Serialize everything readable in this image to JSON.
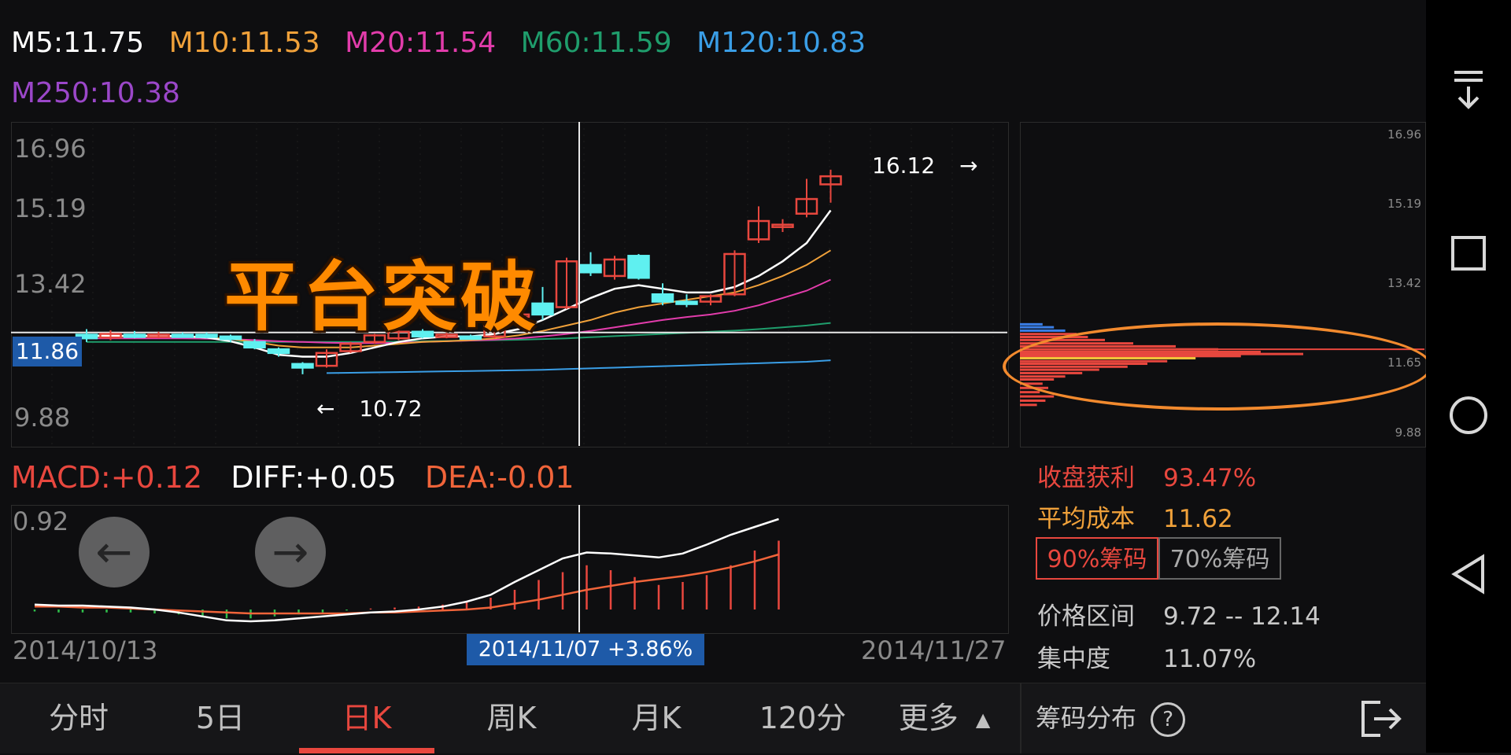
{
  "ma": {
    "m5": "M5:11.75",
    "m10": "M10:11.53",
    "m20": "M20:11.54",
    "m60": "M60:11.59",
    "m120": "M120:10.83",
    "m250": "M250:10.38"
  },
  "colors": {
    "m5": "#ffffff",
    "m10": "#f0a13a",
    "m20": "#e23cab",
    "m60": "#1f9d6c",
    "m120": "#3a9ee6",
    "m250": "#9b47c9",
    "up": "#e8473e",
    "down": "#5ff0f0",
    "accent": "#e8473e",
    "orange": "#f28a2e",
    "label_blue": "#1e5aa8"
  },
  "price_axis": [
    "16.96",
    "15.19",
    "13.42",
    "11.86",
    "9.88"
  ],
  "current_price_tag": "11.86",
  "chip_axis": [
    "16.96",
    "15.19",
    "13.42",
    "11.65",
    "9.88"
  ],
  "title_overlay": "平台突破",
  "annotations": {
    "high": "16.12",
    "low": "10.72",
    "high_arrow": "→",
    "low_arrow": "←"
  },
  "macd": {
    "macd": "MACD:+0.12",
    "diff": "DIFF:+0.05",
    "dea": "DEA:-0.01",
    "axis_top": "0.92"
  },
  "nav": {
    "prev_icon": "←",
    "next_icon": "→"
  },
  "dates": {
    "start": "2014/10/13",
    "selected": "2014/11/07  +3.86%",
    "end": "2014/11/27"
  },
  "chip_stats": {
    "profit_label": "收盘获利",
    "profit_value": "93.47%",
    "avg_cost_label": "平均成本",
    "avg_cost_value": "11.62",
    "btn_90": "90%筹码",
    "btn_70": "70%筹码",
    "range_label": "价格区间",
    "range_value": "9.72 -- 12.14",
    "concentration_label": "集中度",
    "concentration_value": "11.07%"
  },
  "tabs": [
    "分时",
    "5日",
    "日K",
    "周K",
    "月K",
    "120分",
    "更多"
  ],
  "active_tab": "日K",
  "more_caret": "▲",
  "chip_footer": {
    "label": "筹码分布",
    "help_icon": "?"
  },
  "chart_data": {
    "type": "candlestick",
    "x_start": "2014/10/13",
    "x_end": "2014/11/27",
    "ylim": [
      9.88,
      16.96
    ],
    "candles": [
      {
        "o": 11.8,
        "c": 11.7,
        "h": 11.95,
        "l": 11.6
      },
      {
        "o": 11.72,
        "c": 11.82,
        "h": 11.92,
        "l": 11.65
      },
      {
        "o": 11.8,
        "c": 11.78,
        "h": 11.9,
        "l": 11.7
      },
      {
        "o": 11.78,
        "c": 11.8,
        "h": 11.88,
        "l": 11.7
      },
      {
        "o": 11.8,
        "c": 11.79,
        "h": 11.86,
        "l": 11.72
      },
      {
        "o": 11.8,
        "c": 11.78,
        "h": 11.86,
        "l": 11.7
      },
      {
        "o": 11.75,
        "c": 11.68,
        "h": 11.8,
        "l": 11.6
      },
      {
        "o": 11.6,
        "c": 11.45,
        "h": 11.68,
        "l": 11.4
      },
      {
        "o": 11.4,
        "c": 11.3,
        "h": 11.45,
        "l": 11.2
      },
      {
        "o": 11.0,
        "c": 10.9,
        "h": 11.05,
        "l": 10.72
      },
      {
        "o": 10.95,
        "c": 11.3,
        "h": 11.4,
        "l": 10.9
      },
      {
        "o": 11.35,
        "c": 11.55,
        "h": 11.6,
        "l": 11.3
      },
      {
        "o": 11.6,
        "c": 11.78,
        "h": 11.82,
        "l": 11.55
      },
      {
        "o": 11.7,
        "c": 11.88,
        "h": 12.0,
        "l": 11.65
      },
      {
        "o": 11.88,
        "c": 11.75,
        "h": 11.95,
        "l": 11.7
      },
      {
        "o": 11.75,
        "c": 11.8,
        "h": 11.85,
        "l": 11.7
      },
      {
        "o": 11.75,
        "c": 11.72,
        "h": 11.8,
        "l": 11.68
      },
      {
        "o": 11.75,
        "c": 12.05,
        "h": 12.1,
        "l": 11.7
      },
      {
        "o": 12.3,
        "c": 12.35,
        "h": 12.5,
        "l": 12.15
      },
      {
        "o": 12.65,
        "c": 12.35,
        "h": 13.1,
        "l": 12.2
      },
      {
        "o": 12.55,
        "c": 13.8,
        "h": 13.9,
        "l": 12.5
      },
      {
        "o": 13.7,
        "c": 13.5,
        "h": 14.05,
        "l": 13.4
      },
      {
        "o": 13.4,
        "c": 13.85,
        "h": 13.95,
        "l": 13.3
      },
      {
        "o": 13.95,
        "c": 13.35,
        "h": 14.0,
        "l": 13.3
      },
      {
        "o": 12.9,
        "c": 12.7,
        "h": 13.2,
        "l": 12.6
      },
      {
        "o": 12.7,
        "c": 12.65,
        "h": 12.9,
        "l": 12.55
      },
      {
        "o": 12.7,
        "c": 12.85,
        "h": 12.9,
        "l": 12.6
      },
      {
        "o": 12.9,
        "c": 14.0,
        "h": 14.1,
        "l": 12.85
      },
      {
        "o": 14.4,
        "c": 14.9,
        "h": 15.3,
        "l": 14.3
      },
      {
        "o": 14.75,
        "c": 14.8,
        "h": 14.95,
        "l": 14.6
      },
      {
        "o": 15.1,
        "c": 15.5,
        "h": 16.05,
        "l": 15.0
      },
      {
        "o": 15.9,
        "c": 16.12,
        "h": 16.3,
        "l": 15.4
      }
    ],
    "ma_lines": {
      "m5": [
        11.78,
        11.77,
        11.77,
        11.77,
        11.76,
        11.72,
        11.62,
        11.45,
        11.25,
        11.2,
        11.2,
        11.3,
        11.45,
        11.6,
        11.7,
        11.75,
        11.75,
        11.82,
        11.95,
        12.2,
        12.5,
        12.8,
        13.05,
        13.15,
        13.05,
        12.95,
        12.95,
        13.1,
        13.4,
        13.8,
        14.3,
        15.19
      ],
      "m10": [
        11.75,
        11.75,
        11.75,
        11.75,
        11.74,
        11.72,
        11.68,
        11.6,
        11.5,
        11.45,
        11.45,
        11.45,
        11.5,
        11.55,
        11.6,
        11.62,
        11.65,
        11.7,
        11.78,
        11.9,
        12.05,
        12.2,
        12.4,
        12.55,
        12.65,
        12.75,
        12.85,
        12.95,
        13.15,
        13.4,
        13.7,
        14.1
      ],
      "m20": [
        11.7,
        11.7,
        11.7,
        11.7,
        11.7,
        11.69,
        11.68,
        11.65,
        11.62,
        11.6,
        11.58,
        11.57,
        11.57,
        11.58,
        11.6,
        11.62,
        11.64,
        11.66,
        11.7,
        11.75,
        11.82,
        11.9,
        12.0,
        12.1,
        12.2,
        12.28,
        12.35,
        12.45,
        12.6,
        12.8,
        13.0,
        13.3
      ],
      "m60": [
        11.6,
        11.6,
        11.6,
        11.6,
        11.6,
        11.6,
        11.6,
        11.6,
        11.6,
        11.6,
        11.6,
        11.6,
        11.6,
        11.61,
        11.62,
        11.63,
        11.64,
        11.65,
        11.66,
        11.68,
        11.7,
        11.73,
        11.76,
        11.79,
        11.82,
        11.85,
        11.88,
        11.91,
        11.95,
        12.0,
        12.05,
        12.12
      ],
      "m120": [
        null,
        null,
        null,
        null,
        null,
        null,
        null,
        null,
        null,
        null,
        10.75,
        10.76,
        10.77,
        10.78,
        10.79,
        10.8,
        10.81,
        10.82,
        10.83,
        10.84,
        10.86,
        10.88,
        10.9,
        10.92,
        10.94,
        10.96,
        10.98,
        11.0,
        11.02,
        11.04,
        11.06,
        11.1
      ]
    },
    "macd_hist": [
      -0.02,
      -0.03,
      -0.03,
      -0.03,
      -0.03,
      -0.04,
      -0.05,
      -0.07,
      -0.09,
      -0.09,
      -0.07,
      -0.05,
      -0.03,
      -0.01,
      0.01,
      0.02,
      0.03,
      0.05,
      0.08,
      0.12,
      0.2,
      0.3,
      0.38,
      0.45,
      0.4,
      0.33,
      0.25,
      0.28,
      0.35,
      0.45,
      0.6,
      0.7
    ],
    "diff": [
      0.05,
      0.04,
      0.04,
      0.03,
      0.02,
      0.0,
      -0.03,
      -0.07,
      -0.11,
      -0.12,
      -0.11,
      -0.09,
      -0.07,
      -0.05,
      -0.03,
      -0.02,
      0.0,
      0.03,
      0.08,
      0.15,
      0.28,
      0.4,
      0.52,
      0.58,
      0.57,
      0.55,
      0.53,
      0.57,
      0.66,
      0.76,
      0.84,
      0.92
    ],
    "dea": [
      0.03,
      0.03,
      0.02,
      0.02,
      0.01,
      0.0,
      -0.01,
      -0.02,
      -0.03,
      -0.04,
      -0.04,
      -0.04,
      -0.04,
      -0.04,
      -0.03,
      -0.03,
      -0.02,
      -0.01,
      0.0,
      0.02,
      0.06,
      0.1,
      0.15,
      0.2,
      0.24,
      0.28,
      0.31,
      0.34,
      0.38,
      0.43,
      0.49,
      0.56
    ],
    "chip_bars": [
      {
        "price": 12.45,
        "len": 0.08,
        "color": "blue"
      },
      {
        "price": 12.38,
        "len": 0.12,
        "color": "blue"
      },
      {
        "price": 12.3,
        "len": 0.16,
        "color": "blue"
      },
      {
        "price": 12.22,
        "len": 0.2,
        "color": "red"
      },
      {
        "price": 12.15,
        "len": 0.24,
        "color": "red"
      },
      {
        "price": 12.08,
        "len": 0.3,
        "color": "red"
      },
      {
        "price": 12.0,
        "len": 0.4,
        "color": "red"
      },
      {
        "price": 11.93,
        "len": 0.55,
        "color": "red"
      },
      {
        "price": 11.86,
        "len": 0.7,
        "color": "red"
      },
      {
        "price": 11.8,
        "len": 0.85,
        "color": "red"
      },
      {
        "price": 11.75,
        "len": 1.0,
        "color": "red"
      },
      {
        "price": 11.7,
        "len": 0.78,
        "color": "red"
      },
      {
        "price": 11.65,
        "len": 0.62,
        "color": "yellow"
      },
      {
        "price": 11.58,
        "len": 0.52,
        "color": "red"
      },
      {
        "price": 11.52,
        "len": 0.45,
        "color": "red"
      },
      {
        "price": 11.45,
        "len": 0.38,
        "color": "red"
      },
      {
        "price": 11.38,
        "len": 0.28,
        "color": "red"
      },
      {
        "price": 11.3,
        "len": 0.22,
        "color": "red"
      },
      {
        "price": 11.22,
        "len": 0.16,
        "color": "red"
      },
      {
        "price": 11.15,
        "len": 0.12,
        "color": "red"
      },
      {
        "price": 11.05,
        "len": 0.08,
        "color": "red"
      },
      {
        "price": 10.95,
        "len": 0.1,
        "color": "red"
      },
      {
        "price": 10.85,
        "len": 0.07,
        "color": "red"
      },
      {
        "price": 10.75,
        "len": 0.12,
        "color": "red"
      },
      {
        "price": 10.65,
        "len": 0.09,
        "color": "red"
      },
      {
        "price": 10.55,
        "len": 0.06,
        "color": "red"
      }
    ]
  }
}
